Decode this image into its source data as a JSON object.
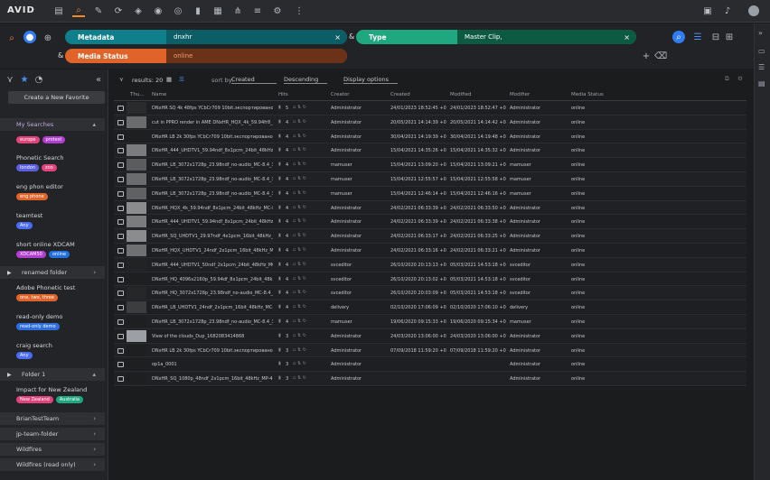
{
  "topbar": {
    "logo": "AVID",
    "icons": [
      "folder-icon",
      "search-icon",
      "edit-icon",
      "share-icon",
      "link-icon",
      "user-icon",
      "record-icon",
      "bookmark-icon",
      "clip-icon",
      "sort-icon",
      "network-icon",
      "process-icon",
      "settings-icon"
    ],
    "right_icons": [
      "image-icon",
      "bell-icon",
      "user-avatar"
    ]
  },
  "search": {
    "criteria": [
      {
        "label": "Metadata",
        "value": "dnxhr",
        "color": "#0f7f8c"
      },
      {
        "label": "Type",
        "value": "Master Clip,",
        "color": "#1fa87f"
      },
      {
        "label": "Media Status",
        "value": "online",
        "color": "#e0642a"
      }
    ],
    "amp": "&"
  },
  "sidebar": {
    "new_favorite": "Create a New Favorite",
    "my_searches": "My Searches",
    "searches": [
      {
        "title": "",
        "tags": [
          {
            "t": "europe",
            "c": "#e0447a"
          },
          {
            "t": "protest",
            "c": "#b03ecf"
          }
        ]
      },
      {
        "title": "Phonetic Search",
        "tags": [
          {
            "t": "london",
            "c": "#5a5fe0"
          },
          {
            "t": "zoo",
            "c": "#e0447a"
          }
        ]
      },
      {
        "title": "eng phon editor",
        "tags": [
          {
            "t": "eng phone",
            "c": "#e0642a"
          }
        ]
      },
      {
        "title": "teamtest",
        "tags": [
          {
            "t": "Any",
            "c": "#4a6cf0"
          }
        ]
      },
      {
        "title": "short online XDCAM",
        "tags": [
          {
            "t": "XDCAM50",
            "c": "#b03ecf"
          },
          {
            "t": "online",
            "c": "#1f6fe0"
          }
        ]
      }
    ],
    "renamed_folder": "renamed folder",
    "searches2": [
      {
        "title": "Adobe Phonetic test",
        "tags": [
          {
            "t": "one, two, three",
            "c": "#e0642a"
          }
        ]
      },
      {
        "title": "read-only demo",
        "tags": [
          {
            "t": "read-only demo",
            "c": "#2e6fe0"
          }
        ]
      },
      {
        "title": "craig search",
        "tags": [
          {
            "t": "Any",
            "c": "#4a6cf0"
          }
        ]
      }
    ],
    "folder1": "Folder 1",
    "impact": {
      "title": "Impact for New Zealand",
      "tags": [
        {
          "t": "New Zealand",
          "c": "#e0447a"
        },
        {
          "t": "Australia",
          "c": "#1fa87f"
        }
      ]
    },
    "teams": [
      "BrianTestTeam",
      "jp-team-folder",
      "Wildfires",
      "Wildfires (read only)"
    ]
  },
  "toolbar": {
    "results": "results: 20",
    "sort_by": "sort by:",
    "sort_field": "Created",
    "order": "Descending",
    "display": "Display options"
  },
  "table": {
    "headers": [
      "Thu...",
      "Name",
      "Hits",
      "Creator",
      "Created",
      "Modified",
      "Modifier",
      "Media Status"
    ],
    "rows": [
      {
        "name": "DNxHR SQ 4k 48fps YCbCr709 10bit.экспортировано.01_...",
        "hits": "5",
        "creator": "Administrator",
        "created": "24/01/2023 18:52:45 +00:0",
        "modified": "24/01/2023 18:52:47 +00:0",
        "modifier": "Administrator",
        "status": "online",
        "thumb": "#2a2b2d"
      },
      {
        "name": "cut in PPRO render in AME DNxHR_HQX_4k_59.94fr8_8...",
        "hits": "4",
        "creator": "Administrator",
        "created": "20/05/2021 14:14:39 +00:0",
        "modified": "20/05/2021 14:14:42 +00:0",
        "modifier": "Administrator",
        "status": "online",
        "thumb": "#6a6c6e"
      },
      {
        "name": "DNxHR LB 2k 30fps YCbCr709 10bit.экспортировано.01_...",
        "hits": "4",
        "creator": "Administrator",
        "created": "30/04/2021 14:19:39 +01:0",
        "modified": "30/04/2021 14:19:48 +01:0",
        "modifier": "Administrator",
        "status": "online",
        "thumb": "#1e1f21"
      },
      {
        "name": "DNxHR_444_UHDTV1_59.94ndf_8x1pcm_24bit_48kHz_...",
        "hits": "4",
        "creator": "Administrator",
        "created": "15/04/2021 14:35:26 +01:0",
        "modified": "15/04/2021 14:35:32 +01:0",
        "modifier": "Administrator",
        "status": "online",
        "thumb": "#7a7c7e"
      },
      {
        "name": "DNxHR_LB_3072x1728p_23.98ndf_no-audio_MC-8.4_3e...",
        "hits": "4",
        "creator": "mamuser",
        "created": "15/04/2021 13:09:20 +01:0",
        "modified": "15/04/2021 13:09:21 +01:0",
        "modifier": "mamuser",
        "status": "online",
        "thumb": "#5a5c5e"
      },
      {
        "name": "DNxHR_LB_3072x1728p_23.98ndf_no-audio_MC-8.4_3e...",
        "hits": "4",
        "creator": "mamuser",
        "created": "15/04/2021 12:55:57 +01:0",
        "modified": "15/04/2021 12:55:58 +01:0",
        "modifier": "mamuser",
        "status": "online",
        "thumb": "#6a6c6e"
      },
      {
        "name": "DNxHR_LB_3072x1728p_23.98ndf_no-audio_MC-8.4_3e...",
        "hits": "4",
        "creator": "mamuser",
        "created": "15/04/2021 12:46:14 +01:0",
        "modified": "15/04/2021 12:46:16 +01:0",
        "modifier": "mamuser",
        "status": "online",
        "thumb": "#5f6163"
      },
      {
        "name": "DNxHR_HQX_4k_59.94ndf_8x1pcm_24bit_48kHz_MC-8...",
        "hits": "4",
        "creator": "Administrator",
        "created": "24/02/2021 06:33:39 +00:0",
        "modified": "24/02/2021 06:33:50 +00:0",
        "modifier": "Administrator",
        "status": "online",
        "thumb": "#8a8c8e"
      },
      {
        "name": "DNxHR_444_UHDTV1_59.94ndf_8x1pcm_24bit_48kHz_...",
        "hits": "4",
        "creator": "Administrator",
        "created": "24/02/2021 06:33:39 +00:0",
        "modified": "24/02/2021 06:33:38 +00:0",
        "modifier": "Administrator",
        "status": "online",
        "thumb": "#7a7c7e"
      },
      {
        "name": "DNxHR_SQ_UHDTV1_29.97ndf_4x1pcm_16bit_48kHz_M...",
        "hits": "4",
        "creator": "Administrator",
        "created": "24/02/2021 06:33:17 +00:0",
        "modified": "24/02/2021 06:33:25 +00:0",
        "modifier": "Administrator",
        "status": "online",
        "thumb": "#8a8c8e"
      },
      {
        "name": "DNxHR_HQX_UHDTV1_24ndf_2x1pcm_16bit_48kHz_MC-...",
        "hits": "4",
        "creator": "Administrator",
        "created": "24/02/2021 06:33:16 +00:0",
        "modified": "24/02/2021 06:33:21 +00:0",
        "modifier": "Administrator",
        "status": "online",
        "thumb": "#6e7072"
      },
      {
        "name": "DNxHR_444_UHDTV1_50ndf_2x1pcm_24bit_48kHz_MC...",
        "hits": "4",
        "creator": "svceditor",
        "created": "26/10/2020 20:13:13 +00:0",
        "modified": "05/03/2021 14:53:18 +00:0",
        "modifier": "svceditor",
        "status": "online",
        "thumb": "#222325"
      },
      {
        "name": "DNxHR_HQ_4096x2160p_59.94df_8x1pcm_24bit_48kHz...",
        "hits": "4",
        "creator": "svceditor",
        "created": "26/10/2020 20:13:02 +00:0",
        "modified": "05/03/2021 14:53:18 +00:0",
        "modifier": "svceditor",
        "status": "online",
        "thumb": "#1e1f21"
      },
      {
        "name": "DNxHR_HQ_3072x1728p_23.98ndf_no-audio_MC-8.4_3e...",
        "hits": "4",
        "creator": "svceditor",
        "created": "26/10/2020 20:03:09 +00:0",
        "modified": "05/03/2021 14:53:18 +00:0",
        "modifier": "svceditor",
        "status": "online",
        "thumb": "#262729"
      },
      {
        "name": "DNxHR_LB_UHDTV1_24ndf_2x1pcm_16bit_48kHz_MC-...",
        "hits": "4",
        "creator": "delivery",
        "created": "02/10/2020 17:06:09 +01:0",
        "modified": "02/10/2020 17:06:10 +01:0",
        "modifier": "delivery",
        "status": "online",
        "thumb": "#3c3d3f"
      },
      {
        "name": "DNxHR_LB_3072x1728p_23.98ndf_no-audio_MC-8.4_3e8f",
        "hits": "4",
        "creator": "mamuser",
        "created": "19/06/2020 09:15:33 +01:0",
        "modified": "19/06/2020 09:15:34 +01:0",
        "modifier": "mamuser",
        "status": "online",
        "thumb": "#1e1f21"
      },
      {
        "name": "View of the clouds_Dup_1682083414868",
        "hits": "3",
        "creator": "Administrator",
        "created": "24/03/2020 13:06:00 +00:0",
        "modified": "24/03/2020 13:06:00 +00:0",
        "modifier": "Administrator",
        "status": "online",
        "thumb": "#9ca0a4"
      },
      {
        "name": "DNxHR LB 2k 30fps YCbCr709 10bit.экспортировано.01_...",
        "hits": "3",
        "creator": "Administrator",
        "created": "07/09/2018 11:59:20 +01:0",
        "modified": "07/09/2018 11:59:20 +01:0",
        "modifier": "Administrator",
        "status": "online",
        "thumb": "#1e1f21"
      },
      {
        "name": "op1a_0001",
        "hits": "3",
        "creator": "Administrator",
        "created": "",
        "modified": "",
        "modifier": "Administrator",
        "status": "online",
        "thumb": "#1e1f21"
      },
      {
        "name": "DNxHR_SQ_1080p_48ndf_2x1pcm_16bit_48kHz_MP-4.4...",
        "hits": "3",
        "creator": "Administrator",
        "created": "",
        "modified": "",
        "modifier": "Administrator",
        "status": "online",
        "thumb": "#1e1f21"
      }
    ]
  },
  "rail": {
    "icons": [
      "collapse-icon",
      "layout-icon",
      "list-icon",
      "panel-icon"
    ]
  }
}
